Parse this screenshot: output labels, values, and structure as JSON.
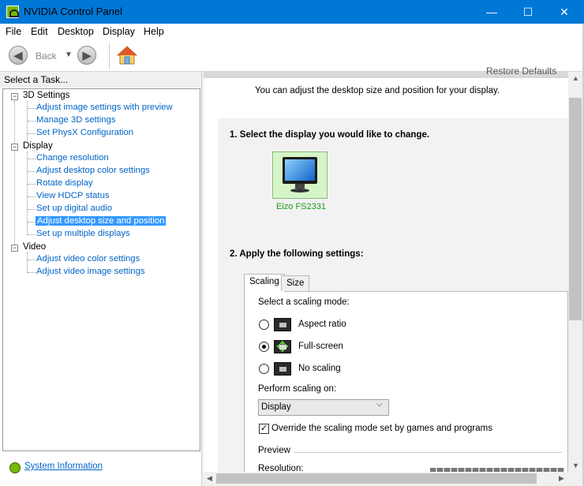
{
  "window": {
    "title": "NVIDIA Control Panel",
    "minimize": "—",
    "maximize": "☐",
    "close": "✕"
  },
  "menu": [
    "File",
    "Edit",
    "Desktop",
    "Display",
    "Help"
  ],
  "toolbar": {
    "back_label": "Back",
    "back_icon": "◀",
    "forward_icon": "▶",
    "dropdown_icon": "▼"
  },
  "sidebar": {
    "header": "Select a Task...",
    "categories": [
      {
        "label": "3D Settings",
        "items": [
          "Adjust image settings with preview",
          "Manage 3D settings",
          "Set PhysX Configuration"
        ]
      },
      {
        "label": "Display",
        "items": [
          "Change resolution",
          "Adjust desktop color settings",
          "Rotate display",
          "View HDCP status",
          "Set up digital audio",
          "Adjust desktop size and position",
          "Set up multiple displays"
        ]
      },
      {
        "label": "Video",
        "items": [
          "Adjust video color settings",
          "Adjust video image settings"
        ]
      }
    ],
    "selected": "Adjust desktop size and position",
    "tree_expander": "−",
    "system_info": "System Information"
  },
  "main": {
    "restore_defaults": "Restore Defaults",
    "intro": "You can adjust the desktop size and position for your display.",
    "step1": "1. Select the display you would like to change.",
    "display_name": "Eizo FS2331",
    "step2": "2. Apply the following settings:",
    "tabs": [
      "Scaling",
      "Size"
    ],
    "scaling_mode_label": "Select a scaling mode:",
    "modes": [
      {
        "label": "Aspect ratio",
        "selected": false
      },
      {
        "label": "Full-screen",
        "selected": true
      },
      {
        "label": "No scaling",
        "selected": false
      }
    ],
    "perform_label": "Perform scaling on:",
    "perform_value": "Display",
    "dropdown_icon": "⌵",
    "checkbox_mark": "✓",
    "override_label": "Override the scaling mode set by games and programs",
    "preview_label": "Preview",
    "resolution_label": "Resolution:"
  },
  "scrollbars": {
    "up": "▲",
    "down": "▼",
    "left": "◀",
    "right": "▶"
  },
  "colors": {
    "titlebar": "#0078d7",
    "link": "#0064c8",
    "selection": "#3399ff",
    "nvidia_green": "#76b900"
  }
}
